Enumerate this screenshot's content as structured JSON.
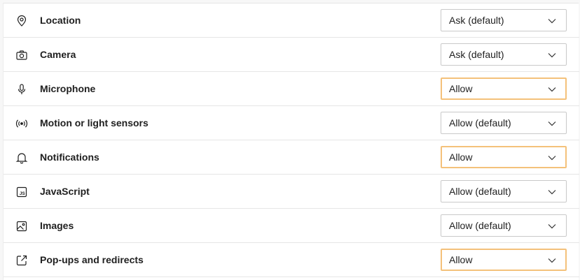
{
  "permissions": [
    {
      "label": "Location",
      "value": "Ask (default)",
      "icon": "location-icon",
      "focused": false
    },
    {
      "label": "Camera",
      "value": "Ask (default)",
      "icon": "camera-icon",
      "focused": false
    },
    {
      "label": "Microphone",
      "value": "Allow",
      "icon": "microphone-icon",
      "focused": true
    },
    {
      "label": "Motion or light sensors",
      "value": "Allow (default)",
      "icon": "sensors-icon",
      "focused": false
    },
    {
      "label": "Notifications",
      "value": "Allow",
      "icon": "bell-icon",
      "focused": true
    },
    {
      "label": "JavaScript",
      "value": "Allow (default)",
      "icon": "javascript-icon",
      "focused": false
    },
    {
      "label": "Images",
      "value": "Allow (default)",
      "icon": "image-icon",
      "focused": false
    },
    {
      "label": "Pop-ups and redirects",
      "value": "Allow",
      "icon": "popup-icon",
      "focused": true
    }
  ],
  "colors": {
    "highlight_border": "#f4c17a",
    "text": "#1f1f1f",
    "divider": "#e6e6e6"
  }
}
